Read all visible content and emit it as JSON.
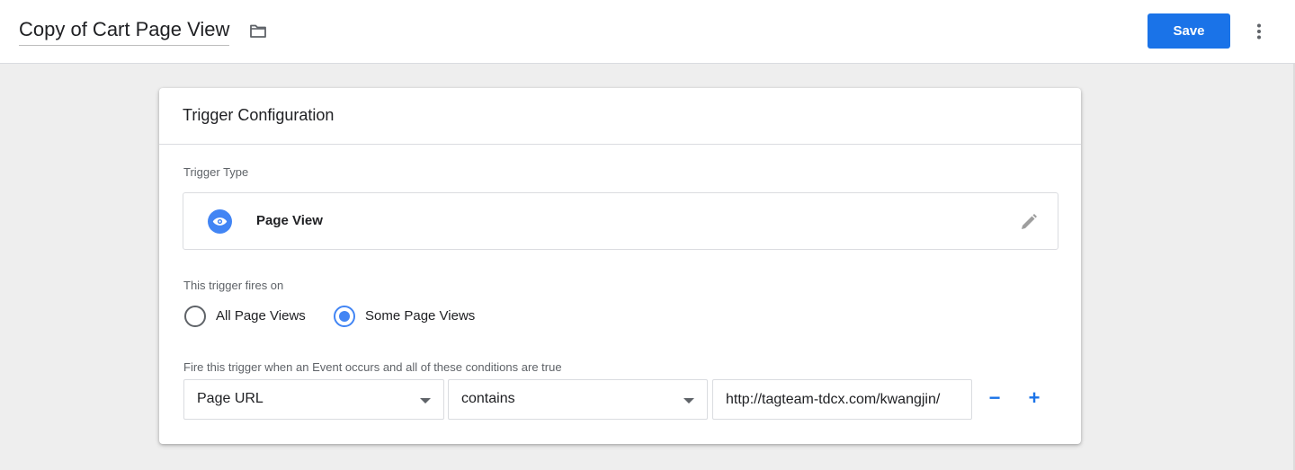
{
  "header": {
    "title": "Copy of Cart Page View",
    "folder_icon": "folder-icon",
    "save_label": "Save",
    "more_icon": "more-vert-icon",
    "accent_color": "#1a73e8"
  },
  "card": {
    "title": "Trigger Configuration",
    "trigger_type_label": "Trigger Type",
    "trigger_type": {
      "icon": "eye-icon",
      "name": "Page View",
      "edit_icon": "pencil-icon"
    },
    "fires_on_label": "This trigger fires on",
    "fires_on_options": [
      {
        "label": "All Page Views",
        "selected": false
      },
      {
        "label": "Some Page Views",
        "selected": true
      }
    ],
    "conditions_label": "Fire this trigger when an Event occurs and all of these conditions are true",
    "condition": {
      "variable": "Page URL",
      "operator": "contains",
      "value": "http://tagteam-tdcx.com/kwangjin/",
      "remove_label": "−",
      "add_label": "+"
    }
  }
}
